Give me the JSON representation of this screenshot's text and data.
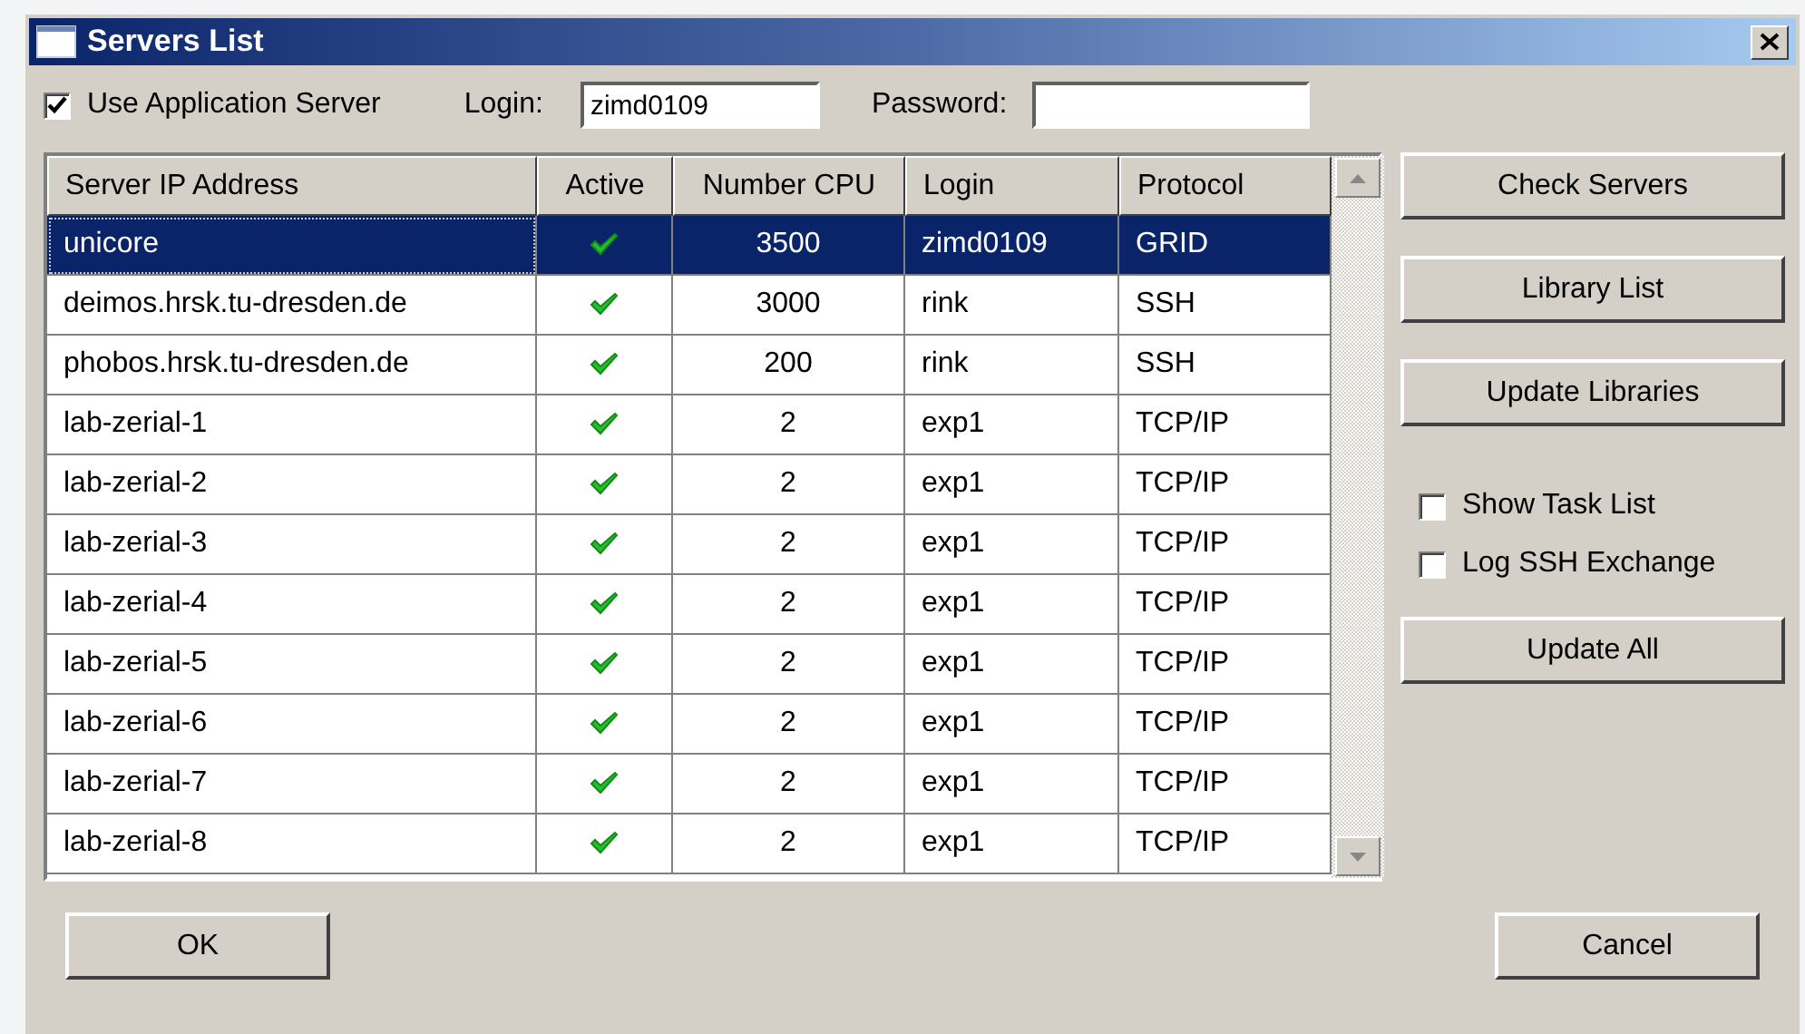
{
  "window": {
    "title": "Servers List"
  },
  "use_app_server": {
    "label": "Use Application Server",
    "checked": true
  },
  "login": {
    "label": "Login:",
    "value": "zimd0109"
  },
  "password": {
    "label": "Password:"
  },
  "table": {
    "columns": [
      "Server IP Address",
      "Active",
      "Number CPU",
      "Login",
      "Protocol"
    ],
    "rows": [
      {
        "server": "unicore",
        "active": true,
        "cpu": "3500",
        "login": "zimd0109",
        "protocol": "GRID",
        "selected": true
      },
      {
        "server": "deimos.hrsk.tu-dresden.de",
        "active": true,
        "cpu": "3000",
        "login": "rink",
        "protocol": "SSH",
        "selected": false
      },
      {
        "server": "phobos.hrsk.tu-dresden.de",
        "active": true,
        "cpu": "200",
        "login": "rink",
        "protocol": "SSH",
        "selected": false
      },
      {
        "server": "lab-zerial-1",
        "active": true,
        "cpu": "2",
        "login": "exp1",
        "protocol": "TCP/IP",
        "selected": false
      },
      {
        "server": "lab-zerial-2",
        "active": true,
        "cpu": "2",
        "login": "exp1",
        "protocol": "TCP/IP",
        "selected": false
      },
      {
        "server": "lab-zerial-3",
        "active": true,
        "cpu": "2",
        "login": "exp1",
        "protocol": "TCP/IP",
        "selected": false
      },
      {
        "server": "lab-zerial-4",
        "active": true,
        "cpu": "2",
        "login": "exp1",
        "protocol": "TCP/IP",
        "selected": false
      },
      {
        "server": "lab-zerial-5",
        "active": true,
        "cpu": "2",
        "login": "exp1",
        "protocol": "TCP/IP",
        "selected": false
      },
      {
        "server": "lab-zerial-6",
        "active": true,
        "cpu": "2",
        "login": "exp1",
        "protocol": "TCP/IP",
        "selected": false
      },
      {
        "server": "lab-zerial-7",
        "active": true,
        "cpu": "2",
        "login": "exp1",
        "protocol": "TCP/IP",
        "selected": false
      },
      {
        "server": "lab-zerial-8",
        "active": true,
        "cpu": "2",
        "login": "exp1",
        "protocol": "TCP/IP",
        "selected": false
      }
    ]
  },
  "side_buttons": [
    "Check Servers",
    "Library List",
    "Update Libraries"
  ],
  "options": [
    {
      "label": "Show Task List",
      "checked": false
    },
    {
      "label": "Log SSH Exchange",
      "checked": false
    }
  ],
  "update_all": "Update All",
  "ok": "OK",
  "cancel": "Cancel"
}
